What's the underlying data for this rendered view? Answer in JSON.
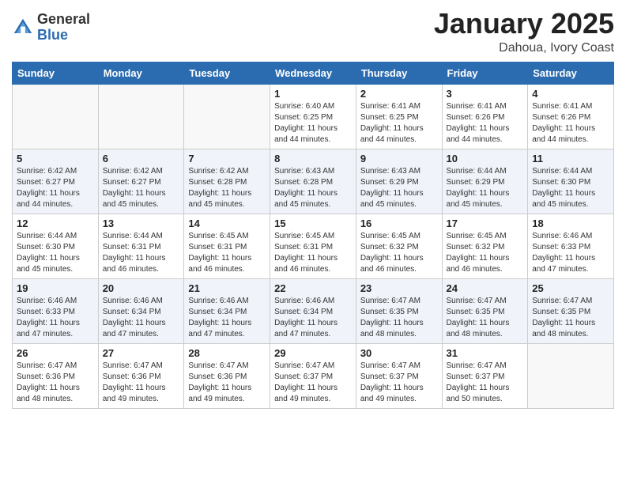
{
  "header": {
    "logo_general": "General",
    "logo_blue": "Blue",
    "title": "January 2025",
    "location": "Dahoua, Ivory Coast"
  },
  "days": [
    "Sunday",
    "Monday",
    "Tuesday",
    "Wednesday",
    "Thursday",
    "Friday",
    "Saturday"
  ],
  "weeks": [
    [
      {
        "date": "",
        "sunrise": "",
        "sunset": "",
        "daylight": ""
      },
      {
        "date": "",
        "sunrise": "",
        "sunset": "",
        "daylight": ""
      },
      {
        "date": "",
        "sunrise": "",
        "sunset": "",
        "daylight": ""
      },
      {
        "date": "1",
        "sunrise": "Sunrise: 6:40 AM",
        "sunset": "Sunset: 6:25 PM",
        "daylight": "Daylight: 11 hours and 44 minutes."
      },
      {
        "date": "2",
        "sunrise": "Sunrise: 6:41 AM",
        "sunset": "Sunset: 6:25 PM",
        "daylight": "Daylight: 11 hours and 44 minutes."
      },
      {
        "date": "3",
        "sunrise": "Sunrise: 6:41 AM",
        "sunset": "Sunset: 6:26 PM",
        "daylight": "Daylight: 11 hours and 44 minutes."
      },
      {
        "date": "4",
        "sunrise": "Sunrise: 6:41 AM",
        "sunset": "Sunset: 6:26 PM",
        "daylight": "Daylight: 11 hours and 44 minutes."
      }
    ],
    [
      {
        "date": "5",
        "sunrise": "Sunrise: 6:42 AM",
        "sunset": "Sunset: 6:27 PM",
        "daylight": "Daylight: 11 hours and 44 minutes."
      },
      {
        "date": "6",
        "sunrise": "Sunrise: 6:42 AM",
        "sunset": "Sunset: 6:27 PM",
        "daylight": "Daylight: 11 hours and 45 minutes."
      },
      {
        "date": "7",
        "sunrise": "Sunrise: 6:42 AM",
        "sunset": "Sunset: 6:28 PM",
        "daylight": "Daylight: 11 hours and 45 minutes."
      },
      {
        "date": "8",
        "sunrise": "Sunrise: 6:43 AM",
        "sunset": "Sunset: 6:28 PM",
        "daylight": "Daylight: 11 hours and 45 minutes."
      },
      {
        "date": "9",
        "sunrise": "Sunrise: 6:43 AM",
        "sunset": "Sunset: 6:29 PM",
        "daylight": "Daylight: 11 hours and 45 minutes."
      },
      {
        "date": "10",
        "sunrise": "Sunrise: 6:44 AM",
        "sunset": "Sunset: 6:29 PM",
        "daylight": "Daylight: 11 hours and 45 minutes."
      },
      {
        "date": "11",
        "sunrise": "Sunrise: 6:44 AM",
        "sunset": "Sunset: 6:30 PM",
        "daylight": "Daylight: 11 hours and 45 minutes."
      }
    ],
    [
      {
        "date": "12",
        "sunrise": "Sunrise: 6:44 AM",
        "sunset": "Sunset: 6:30 PM",
        "daylight": "Daylight: 11 hours and 45 minutes."
      },
      {
        "date": "13",
        "sunrise": "Sunrise: 6:44 AM",
        "sunset": "Sunset: 6:31 PM",
        "daylight": "Daylight: 11 hours and 46 minutes."
      },
      {
        "date": "14",
        "sunrise": "Sunrise: 6:45 AM",
        "sunset": "Sunset: 6:31 PM",
        "daylight": "Daylight: 11 hours and 46 minutes."
      },
      {
        "date": "15",
        "sunrise": "Sunrise: 6:45 AM",
        "sunset": "Sunset: 6:31 PM",
        "daylight": "Daylight: 11 hours and 46 minutes."
      },
      {
        "date": "16",
        "sunrise": "Sunrise: 6:45 AM",
        "sunset": "Sunset: 6:32 PM",
        "daylight": "Daylight: 11 hours and 46 minutes."
      },
      {
        "date": "17",
        "sunrise": "Sunrise: 6:45 AM",
        "sunset": "Sunset: 6:32 PM",
        "daylight": "Daylight: 11 hours and 46 minutes."
      },
      {
        "date": "18",
        "sunrise": "Sunrise: 6:46 AM",
        "sunset": "Sunset: 6:33 PM",
        "daylight": "Daylight: 11 hours and 47 minutes."
      }
    ],
    [
      {
        "date": "19",
        "sunrise": "Sunrise: 6:46 AM",
        "sunset": "Sunset: 6:33 PM",
        "daylight": "Daylight: 11 hours and 47 minutes."
      },
      {
        "date": "20",
        "sunrise": "Sunrise: 6:46 AM",
        "sunset": "Sunset: 6:34 PM",
        "daylight": "Daylight: 11 hours and 47 minutes."
      },
      {
        "date": "21",
        "sunrise": "Sunrise: 6:46 AM",
        "sunset": "Sunset: 6:34 PM",
        "daylight": "Daylight: 11 hours and 47 minutes."
      },
      {
        "date": "22",
        "sunrise": "Sunrise: 6:46 AM",
        "sunset": "Sunset: 6:34 PM",
        "daylight": "Daylight: 11 hours and 47 minutes."
      },
      {
        "date": "23",
        "sunrise": "Sunrise: 6:47 AM",
        "sunset": "Sunset: 6:35 PM",
        "daylight": "Daylight: 11 hours and 48 minutes."
      },
      {
        "date": "24",
        "sunrise": "Sunrise: 6:47 AM",
        "sunset": "Sunset: 6:35 PM",
        "daylight": "Daylight: 11 hours and 48 minutes."
      },
      {
        "date": "25",
        "sunrise": "Sunrise: 6:47 AM",
        "sunset": "Sunset: 6:35 PM",
        "daylight": "Daylight: 11 hours and 48 minutes."
      }
    ],
    [
      {
        "date": "26",
        "sunrise": "Sunrise: 6:47 AM",
        "sunset": "Sunset: 6:36 PM",
        "daylight": "Daylight: 11 hours and 48 minutes."
      },
      {
        "date": "27",
        "sunrise": "Sunrise: 6:47 AM",
        "sunset": "Sunset: 6:36 PM",
        "daylight": "Daylight: 11 hours and 49 minutes."
      },
      {
        "date": "28",
        "sunrise": "Sunrise: 6:47 AM",
        "sunset": "Sunset: 6:36 PM",
        "daylight": "Daylight: 11 hours and 49 minutes."
      },
      {
        "date": "29",
        "sunrise": "Sunrise: 6:47 AM",
        "sunset": "Sunset: 6:37 PM",
        "daylight": "Daylight: 11 hours and 49 minutes."
      },
      {
        "date": "30",
        "sunrise": "Sunrise: 6:47 AM",
        "sunset": "Sunset: 6:37 PM",
        "daylight": "Daylight: 11 hours and 49 minutes."
      },
      {
        "date": "31",
        "sunrise": "Sunrise: 6:47 AM",
        "sunset": "Sunset: 6:37 PM",
        "daylight": "Daylight: 11 hours and 50 minutes."
      },
      {
        "date": "",
        "sunrise": "",
        "sunset": "",
        "daylight": ""
      }
    ]
  ]
}
